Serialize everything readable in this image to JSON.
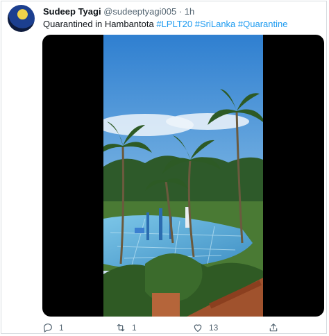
{
  "tweet": {
    "display_name": "Sudeep Tyagi",
    "handle": "@sudeeptyagi005",
    "separator": "·",
    "time": "1h",
    "text_prefix": "Quarantined in Hambantota ",
    "hashtags": [
      "#LPLT20",
      "#SriLanka",
      "#Quarantine"
    ]
  },
  "actions": {
    "reply_count": "1",
    "retweet_count": "1",
    "like_count": "13",
    "icons": [
      "reply-icon",
      "retweet-icon",
      "like-icon",
      "share-icon"
    ]
  },
  "colors": {
    "hashtag": "#1d9bf0",
    "secondary_text": "#536471",
    "media_background": "#000000"
  }
}
